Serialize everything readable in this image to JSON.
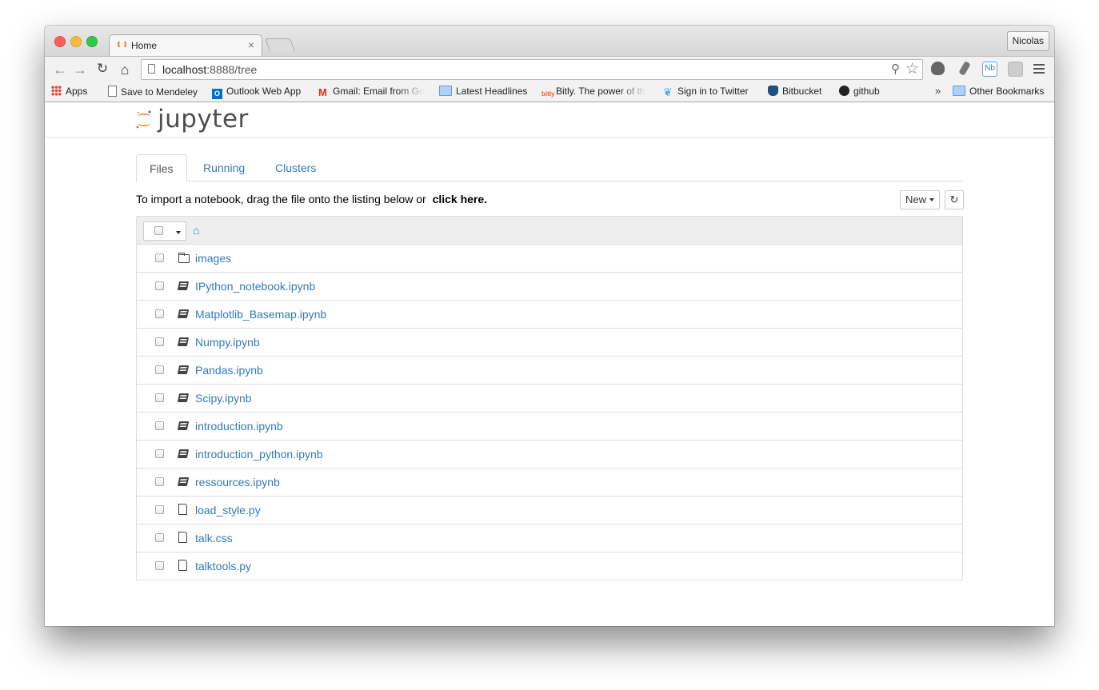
{
  "browser": {
    "tab_title": "Home",
    "tab_close": "×",
    "profile_name": "Nicolas",
    "url_host": "localhost",
    "url_rest": ":8888/tree",
    "ext3_label": "Nb",
    "bookmarks": [
      {
        "label": "Apps",
        "icon": "apps-grid-icon"
      },
      {
        "label": "Save to Mendeley",
        "icon": "page-icon"
      },
      {
        "label": "Outlook Web App",
        "icon": "outlook-icon"
      },
      {
        "label": "Gmail: Email from Go",
        "icon": "gmail-icon"
      },
      {
        "label": "Latest Headlines",
        "icon": "folder-icon"
      },
      {
        "label": "Bitly. The power of th",
        "icon": "bitly-icon"
      },
      {
        "label": "Sign in to Twitter",
        "icon": "twitter-icon"
      },
      {
        "label": "Bitbucket",
        "icon": "bitbucket-icon"
      },
      {
        "label": "github",
        "icon": "github-icon"
      }
    ],
    "bookmarks_more": "»",
    "other_bookmarks": "Other Bookmarks"
  },
  "jupyter": {
    "logo_text": "jupyter",
    "tabs": [
      "Files",
      "Running",
      "Clusters"
    ],
    "import_text": "To import a notebook, drag the file onto the listing below or",
    "import_link": "click here.",
    "new_button": "New",
    "items": [
      {
        "name": "images",
        "type": "folder"
      },
      {
        "name": "IPython_notebook.ipynb",
        "type": "notebook"
      },
      {
        "name": "Matplotlib_Basemap.ipynb",
        "type": "notebook"
      },
      {
        "name": "Numpy.ipynb",
        "type": "notebook"
      },
      {
        "name": "Pandas.ipynb",
        "type": "notebook"
      },
      {
        "name": "Scipy.ipynb",
        "type": "notebook"
      },
      {
        "name": "introduction.ipynb",
        "type": "notebook"
      },
      {
        "name": "introduction_python.ipynb",
        "type": "notebook"
      },
      {
        "name": "ressources.ipynb",
        "type": "notebook"
      },
      {
        "name": "load_style.py",
        "type": "file"
      },
      {
        "name": "talk.css",
        "type": "file"
      },
      {
        "name": "talktools.py",
        "type": "file"
      }
    ]
  },
  "colors": {
    "link": "#337ab7",
    "jupyter_orange": "#f37726"
  }
}
